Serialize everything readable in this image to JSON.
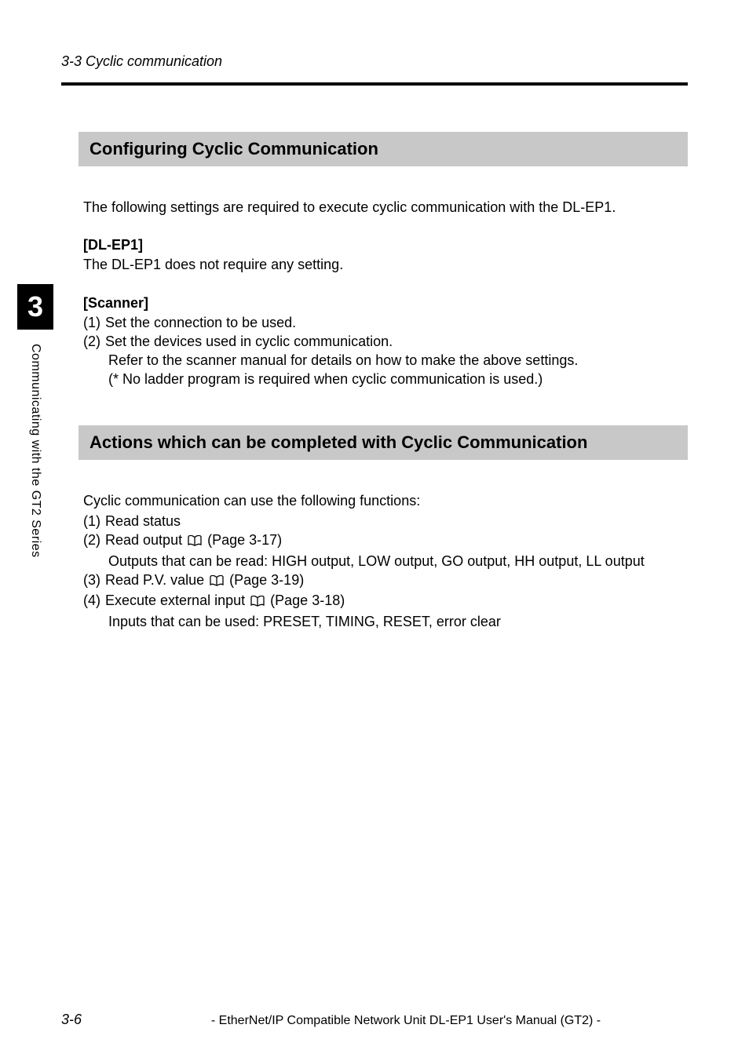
{
  "header": {
    "section_label": "3-3 Cyclic communication"
  },
  "side": {
    "chapter_number": "3",
    "vertical_label": "Communicating with the GT2 Series"
  },
  "section1": {
    "heading": "Configuring Cyclic Communication",
    "intro": "The following settings are required to execute cyclic communication with the DL-EP1.",
    "dl_heading": "[DL-EP1]",
    "dl_text": "The DL-EP1 does not require any setting.",
    "scanner_heading": "[Scanner]",
    "items": [
      {
        "num": "(1)",
        "text": "Set the connection to be used."
      },
      {
        "num": "(2)",
        "text": "Set the devices used in cyclic communication."
      }
    ],
    "indent1": "Refer to the scanner manual for details on how to make the above settings.",
    "indent2": "(* No ladder program is required when cyclic communication is used.)"
  },
  "section2": {
    "heading": "Actions which can be completed with Cyclic Communication",
    "intro": "Cyclic communication can use the following functions:",
    "item1_num": "(1)",
    "item1_text": "Read status",
    "item2_num": "(2)",
    "item2_prefix": "Read output",
    "item2_page": "(Page 3-17)",
    "item2_indent": "Outputs that can be read: HIGH output, LOW output, GO output, HH output, LL output",
    "item3_num": "(3)",
    "item3_prefix": "Read P.V. value",
    "item3_page": "(Page 3-19)",
    "item4_num": "(4)",
    "item4_prefix": "Execute external input",
    "item4_page": "(Page 3-18)",
    "item4_indent": "Inputs that can be used: PRESET, TIMING, RESET, error clear"
  },
  "footer": {
    "page_number": "3-6",
    "title": "- EtherNet/IP Compatible Network Unit DL-EP1 User's Manual (GT2) -"
  }
}
